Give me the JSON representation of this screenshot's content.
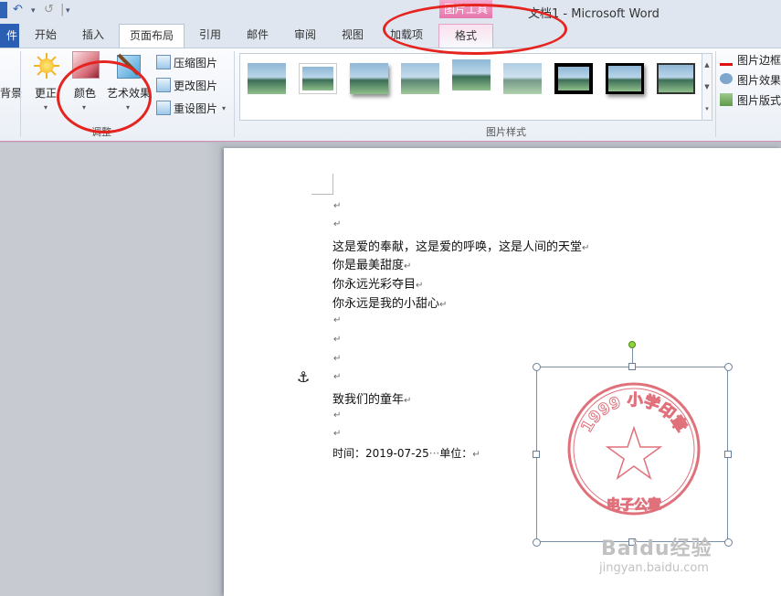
{
  "window": {
    "title": "文档1 - Microsoft Word",
    "context_tab_header": "图片工具"
  },
  "quick_access": {
    "undo_icon": "undo-icon",
    "redo_icon": "redo-icon",
    "customize_icon": "customize-qat-icon",
    "redo_glyph": "↺",
    "undo_glyph": "↶",
    "dropdown_glyph": "▾",
    "separator_glyph": "|",
    "customize_glyph": "▾"
  },
  "tabs": [
    {
      "label": "件",
      "active": false
    },
    {
      "label": "开始",
      "active": false
    },
    {
      "label": "插入",
      "active": false
    },
    {
      "label": "页面布局",
      "active": true
    },
    {
      "label": "引用",
      "active": false
    },
    {
      "label": "邮件",
      "active": false
    },
    {
      "label": "审阅",
      "active": false
    },
    {
      "label": "视图",
      "active": false
    },
    {
      "label": "加载项",
      "active": false
    },
    {
      "label": "格式",
      "active": false,
      "contextual": true
    }
  ],
  "ribbon": {
    "remove_background_label": "背景",
    "corrections_label": "更正",
    "color_label": "颜色",
    "artistic_effects_label": "艺术效果",
    "compress_label": "压缩图片",
    "change_label": "更改图片",
    "reset_label": "重设图片",
    "adjust_group_caption": "调整",
    "styles_group_caption": "图片样式",
    "border_label": "图片边框",
    "effects_label": "图片效果",
    "layout_label": "图片版式",
    "dropdown_glyph": "▾",
    "gallery_up": "▲",
    "gallery_down": "▼",
    "gallery_more": "▾"
  },
  "gallery_styles": [
    {
      "style": "plain"
    },
    {
      "style": "soft-frame"
    },
    {
      "style": "shadow"
    },
    {
      "style": "soft-edge"
    },
    {
      "style": "reflected"
    },
    {
      "style": "feather"
    },
    {
      "style": "thick-black-frame"
    },
    {
      "style": "black-frame-shadow"
    },
    {
      "style": "thin-frame"
    }
  ],
  "document": {
    "lines": [
      "这是爱的奉献，这是爱的呼唤，这是人间的天堂",
      "你是最美甜度",
      "你永远光彩夺目",
      "你永远是我的小甜心",
      "致我们的童年"
    ],
    "paragraph_mark": "↵",
    "time_label": "时间：",
    "time_value": "2019-07-25",
    "dots": "···",
    "unit_label": "单位：",
    "anchor_glyph": "⚓"
  },
  "seal": {
    "top_text": "1999 小学印章",
    "bottom_text": "电子公章",
    "color": "#e0707a"
  },
  "watermark": {
    "logo": "Baidu经验",
    "url": "jingyan.baidu.com"
  },
  "colors": {
    "file_tab": "#2a5fb4",
    "context_tab": "#e676ac",
    "annotation": "#e52420",
    "seal": "#e0707a"
  }
}
